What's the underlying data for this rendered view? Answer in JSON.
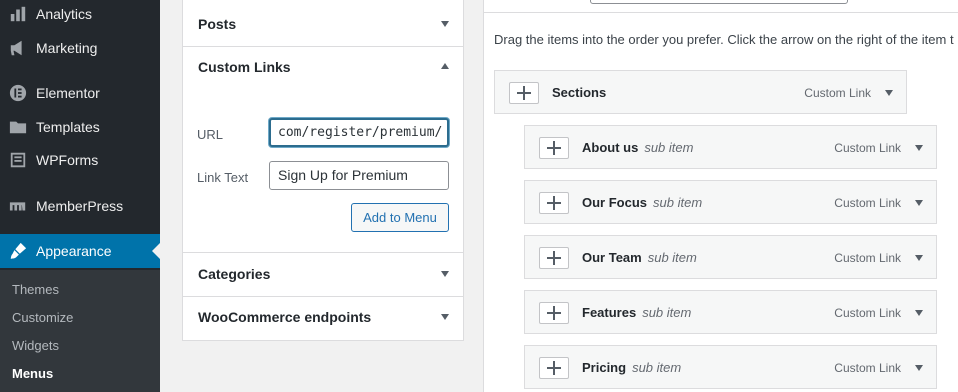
{
  "sidebar": {
    "items": [
      {
        "label": "Analytics",
        "icon": "bar-chart-icon"
      },
      {
        "label": "Marketing",
        "icon": "megaphone-icon"
      },
      {
        "label": "Elementor",
        "icon": "elementor-icon"
      },
      {
        "label": "Templates",
        "icon": "folder-icon"
      },
      {
        "label": "WPForms",
        "icon": "form-icon"
      },
      {
        "label": "MemberPress",
        "icon": "memberpress-icon"
      },
      {
        "label": "Appearance",
        "icon": "paintbrush-icon"
      }
    ],
    "submenu": [
      "Themes",
      "Customize",
      "Widgets",
      "Menus"
    ],
    "active_color": "#0073aa"
  },
  "accordion": {
    "posts": "Posts",
    "custom_links": "Custom Links",
    "url_label": "URL",
    "url_value": "com/register/premium/",
    "link_text_label": "Link Text",
    "link_text_value": "Sign Up for Premium",
    "add_button": "Add to Menu",
    "categories": "Categories",
    "woo": "WooCommerce endpoints"
  },
  "structure": {
    "instructions": "Drag the items into the order you prefer. Click the arrow on the right of the item t",
    "items": [
      {
        "title": "Sections",
        "sub": "",
        "type": "Custom Link"
      },
      {
        "title": "About us",
        "sub": "sub item",
        "type": "Custom Link"
      },
      {
        "title": "Our Focus",
        "sub": "sub item",
        "type": "Custom Link"
      },
      {
        "title": "Our Team",
        "sub": "sub item",
        "type": "Custom Link"
      },
      {
        "title": "Features",
        "sub": "sub item",
        "type": "Custom Link"
      },
      {
        "title": "Pricing",
        "sub": "sub item",
        "type": "Custom Link"
      }
    ]
  }
}
